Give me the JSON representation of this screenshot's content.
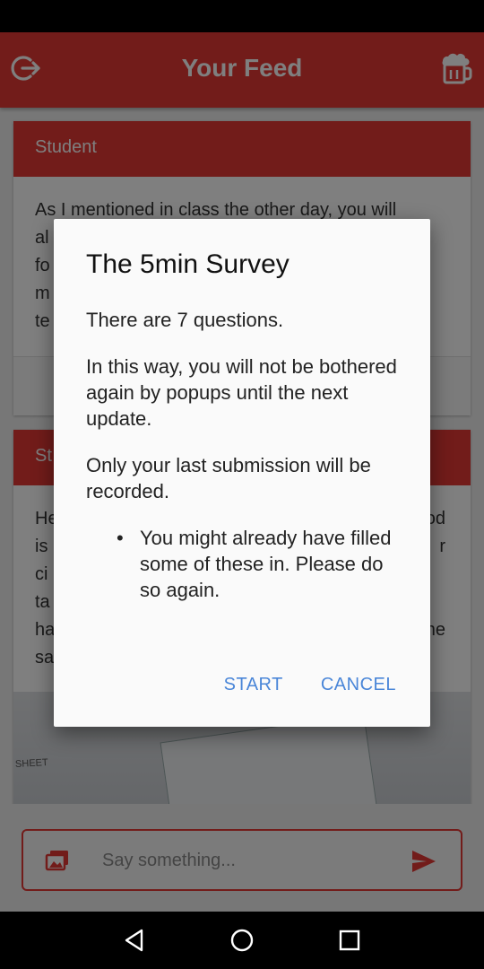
{
  "app_bar": {
    "title": "Your Feed",
    "left_icon": "logout-icon",
    "right_icon": "beer-mug-icon",
    "accent": "#e53935"
  },
  "feed": {
    "cards": [
      {
        "header": "Student",
        "text_lines": [
          "As I mentioned in class the other day, you will",
          "al",
          "fo",
          "m",
          "te"
        ]
      },
      {
        "header": "St",
        "text_lines": [
          "He",
          "is",
          "ci",
          "ta",
          "ha",
          "sa"
        ],
        "text_right_lines": [
          "od",
          "r",
          "",
          "",
          "ne"
        ],
        "photo_label": "SHEET"
      }
    ]
  },
  "composer": {
    "placeholder": "Say something...",
    "gallery_icon": "gallery-icon",
    "send_icon": "send-icon"
  },
  "dialog": {
    "title": "The 5min Survey",
    "paragraphs": [
      "There are 7 questions.",
      "In this way, you will not be bothered again by popups until the next update.",
      "Only your last submission will be recorded."
    ],
    "bullets": [
      "You might already have filled some of these in. Please do so again."
    ],
    "start_label": "START",
    "cancel_label": "CANCEL",
    "button_color": "#4a86d8"
  },
  "nav": {
    "back_icon": "back-triangle-icon",
    "home_icon": "home-circle-icon",
    "recents_icon": "recents-square-icon"
  }
}
